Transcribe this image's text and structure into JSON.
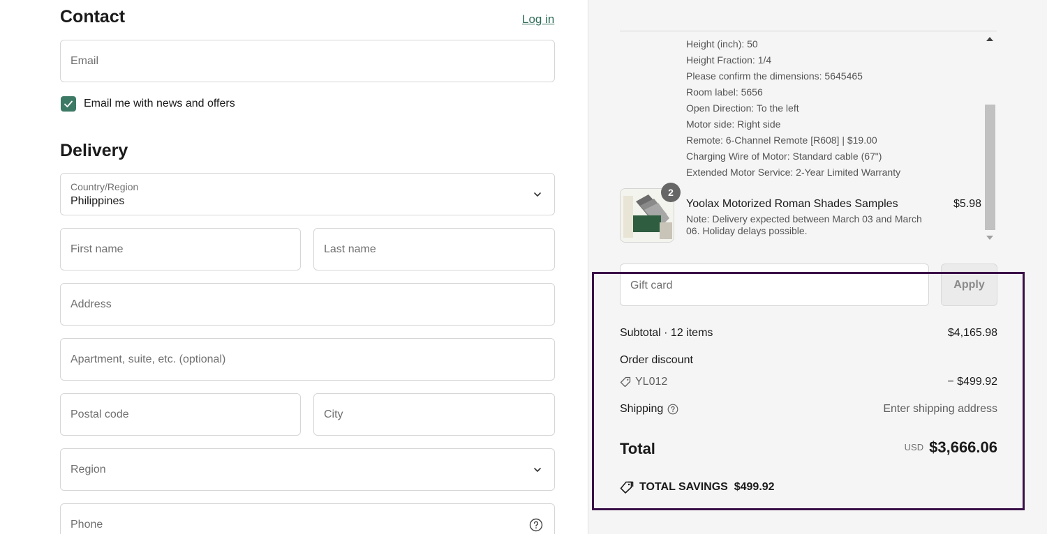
{
  "contact": {
    "title": "Contact",
    "login_link": "Log in",
    "email_placeholder": "Email",
    "newsletter_label": "Email me with news and offers"
  },
  "delivery": {
    "title": "Delivery",
    "country_label": "Country/Region",
    "country_value": "Philippines",
    "first_name_placeholder": "First name",
    "last_name_placeholder": "Last name",
    "address_placeholder": "Address",
    "apartment_placeholder": "Apartment, suite, etc. (optional)",
    "postal_placeholder": "Postal code",
    "city_placeholder": "City",
    "region_placeholder": "Region",
    "phone_placeholder": "Phone"
  },
  "summary": {
    "product_options": [
      "Height (inch): 50",
      "Height Fraction: 1/4",
      "Please confirm the dimensions: 5645465",
      "Room label: 5656",
      "Open Direction: To the left",
      "Motor side: Right side",
      "Remote: 6-Channel Remote [R608] | $19.00",
      "Charging Wire of Motor: Standard cable (67\")",
      "Extended Motor Service: 2-Year Limited Warranty"
    ],
    "product": {
      "quantity": "2",
      "name": "Yoolax Motorized Roman Shades Samples",
      "note": "Note: Delivery expected between March 03 and March 06. Holiday delays possible.",
      "price": "$5.98"
    },
    "gift_placeholder": "Gift card",
    "apply_label": "Apply",
    "subtotal_label": "Subtotal · 12 items",
    "subtotal_value": "$4,165.98",
    "discount_label": "Order discount",
    "discount_code": "YL012",
    "discount_value": "− $499.92",
    "shipping_label": "Shipping",
    "shipping_value": "Enter shipping address",
    "total_label": "Total",
    "total_currency": "USD",
    "total_value": "$3,666.06",
    "savings_label": "TOTAL SAVINGS",
    "savings_value": "$499.92"
  },
  "colors": {
    "accent": "#3d7a66",
    "link": "#2e6b57",
    "highlight_border": "#3a0f47",
    "summary_bg": "#f5f5f5"
  }
}
